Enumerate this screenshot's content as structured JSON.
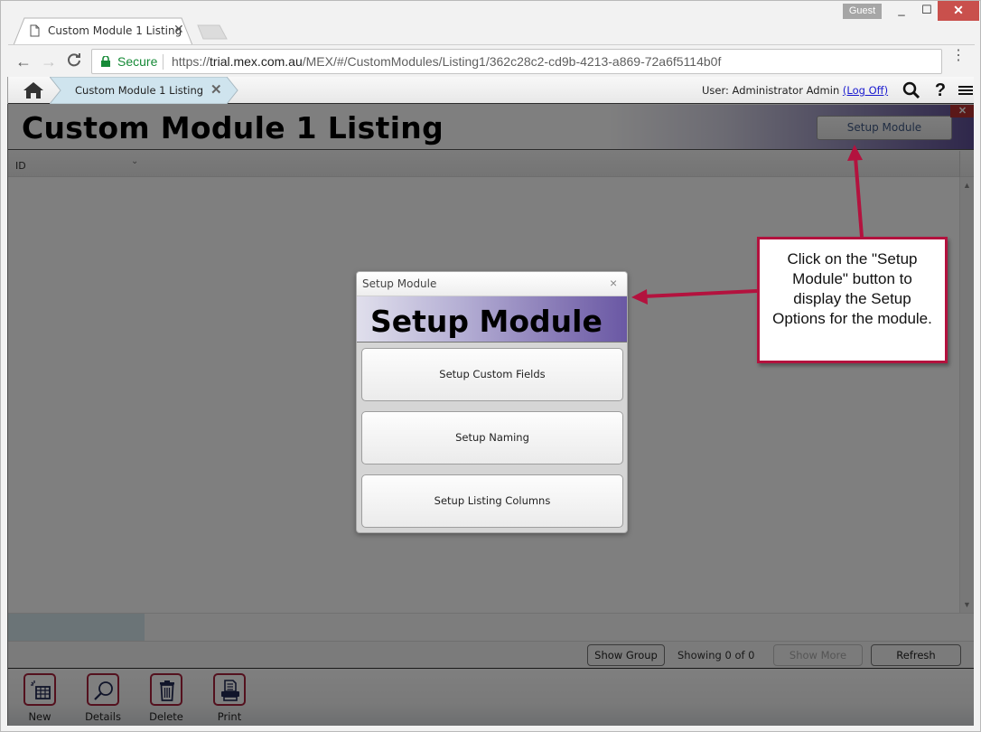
{
  "browser": {
    "tab_title": "Custom Module 1 Listing",
    "tab_close": "✕",
    "profile_label": "Guest",
    "window_controls": {
      "minimize": "_",
      "maximize": "☐",
      "close": "✕"
    },
    "nav": {
      "back": "←",
      "forward": "→",
      "reload": "C"
    },
    "security_label": "Secure",
    "url_scheme": "https://",
    "url_host": "trial.mex.com.au",
    "url_path": "/MEX/#/CustomModules/Listing1/362c28c2-cd9b-4213-a869-72a6f5114b0f",
    "menu_icon": "⋮"
  },
  "app": {
    "breadcrumb": {
      "label": "Custom Module 1 Listing",
      "close": "✕"
    },
    "user": {
      "prefix": "User: Administrator Admin",
      "logoff": "(Log Off)"
    },
    "help_icon": "?",
    "page_title": "Custom Module 1 Listing",
    "setup_button": "Setup Module",
    "page_close": "✕",
    "grid": {
      "columns": [
        {
          "label": "ID",
          "sort_icon": "⌄"
        }
      ],
      "rows": []
    },
    "footer": {
      "show_group": "Show Group",
      "showing": "Showing 0 of 0",
      "show_more": "Show More",
      "refresh": "Refresh"
    },
    "toolbar": [
      {
        "id": "new",
        "label": "New",
        "icon": "new-record-icon"
      },
      {
        "id": "details",
        "label": "Details",
        "icon": "magnifier-icon"
      },
      {
        "id": "delete",
        "label": "Delete",
        "icon": "trash-icon"
      },
      {
        "id": "print",
        "label": "Print",
        "icon": "printer-icon"
      }
    ],
    "accent_color": "#a8223c"
  },
  "dialog": {
    "title": "Setup Module",
    "close": "×",
    "heading": "Setup Module",
    "options": [
      {
        "label": "Setup Custom Fields"
      },
      {
        "label": "Setup Naming"
      },
      {
        "label": "Setup Listing Columns"
      }
    ]
  },
  "annotation": {
    "text": "Click on the \"Setup Module\" button to display the Setup Options for the module.",
    "color": "#b3123e"
  }
}
